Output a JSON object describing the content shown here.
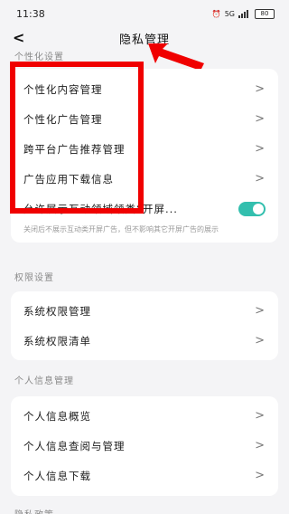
{
  "status": {
    "time": "11:38",
    "network": "5G",
    "battery": "80"
  },
  "header": {
    "title": "隐私管理"
  },
  "sections": {
    "personalization": {
      "title": "个性化设置",
      "rows": [
        "个性化内容管理",
        "个性化广告管理",
        "跨平台广告推荐管理",
        "广告应用下载信息"
      ],
      "toggle_label": "允许展示互动领域领类“开屏...",
      "note": "关闭后不展示互动类开屏广告，但不影响其它开屏广告的展示"
    },
    "permissions": {
      "title": "权限设置",
      "rows": [
        "系统权限管理",
        "系统权限清单"
      ]
    },
    "personal_info": {
      "title": "个人信息管理",
      "rows": [
        "个人信息概览",
        "个人信息查阅与管理",
        "个人信息下载"
      ]
    },
    "footer_section": {
      "title": "隐私政策"
    }
  },
  "icons": {
    "back": "back-arrow-icon",
    "chevron": "chevron-right-icon",
    "battery": "battery-icon"
  },
  "colors": {
    "toggle_on": "#33bfae",
    "annotation": "#f00000"
  }
}
